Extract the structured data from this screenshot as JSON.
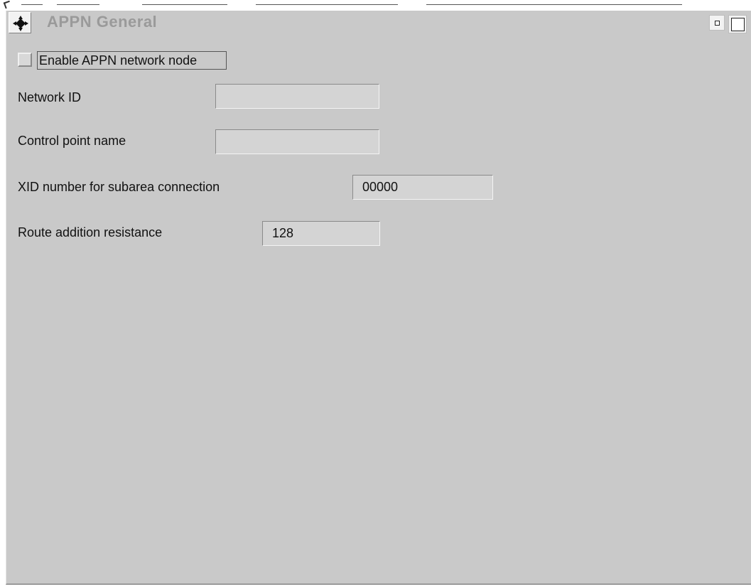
{
  "window": {
    "title": "APPN General",
    "system_menu_icon": "move-arrows-icon",
    "minimize_icon": "minimize-icon",
    "maximize_icon": "maximize-icon"
  },
  "form": {
    "enable_appn": {
      "label": "Enable APPN network node",
      "checked": false
    },
    "network_id": {
      "label": "Network ID",
      "value": ""
    },
    "control_point_name": {
      "label": "Control point name",
      "value": ""
    },
    "xid_number": {
      "label": "XID number for subarea connection",
      "value": "00000"
    },
    "route_addition_resistance": {
      "label": "Route addition resistance",
      "value": "128"
    }
  }
}
